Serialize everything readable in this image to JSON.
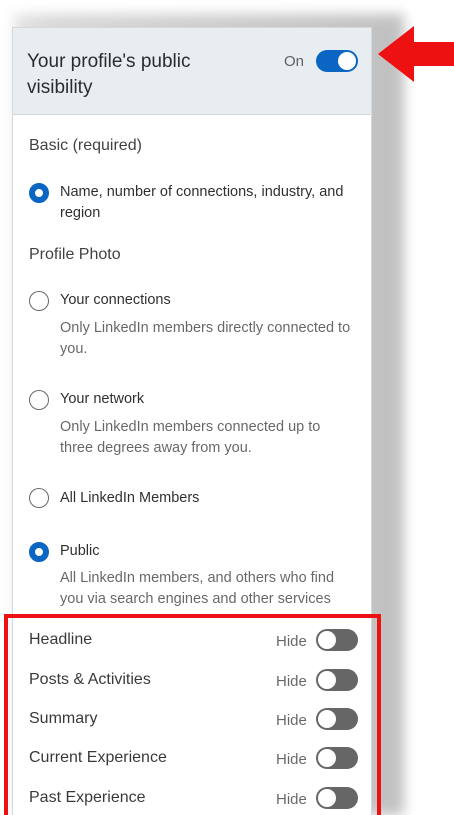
{
  "header": {
    "title": "Your profile's public visibility",
    "state_label": "On",
    "toggle_on": true
  },
  "basic": {
    "label": "Basic (required)",
    "option": {
      "label": "Name, number of connections, industry, and region",
      "checked": true
    }
  },
  "profile_photo": {
    "label": "Profile Photo",
    "options": [
      {
        "label": "Your connections",
        "description": "Only LinkedIn members directly connected to you.",
        "checked": false
      },
      {
        "label": "Your network",
        "description": "Only LinkedIn members connected up to three degrees away from you.",
        "checked": false
      },
      {
        "label": "All LinkedIn Members",
        "description": "",
        "checked": false
      },
      {
        "label": "Public",
        "description": "All LinkedIn members, and others who find you via search engines and other services",
        "checked": true
      }
    ]
  },
  "fields": [
    {
      "label": "Headline",
      "state_label": "Hide",
      "toggle_on": false
    },
    {
      "label": "Posts & Activities",
      "state_label": "Hide",
      "toggle_on": false
    },
    {
      "label": "Summary",
      "state_label": "Hide",
      "toggle_on": false
    },
    {
      "label": "Current Experience",
      "state_label": "Hide",
      "toggle_on": false
    },
    {
      "label": "Past Experience",
      "state_label": "Hide",
      "toggle_on": false
    }
  ],
  "colors": {
    "accent": "#0a66c2",
    "annotation": "#ee1111",
    "header_bg": "#e8edf2",
    "toggle_off": "#666666"
  }
}
